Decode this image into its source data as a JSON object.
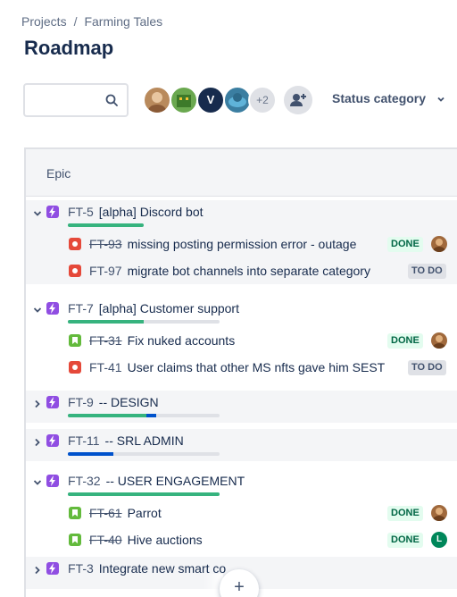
{
  "breadcrumb": {
    "root": "Projects",
    "separator": "/",
    "project": "Farming Tales"
  },
  "title": "Roadmap",
  "search": {
    "placeholder": "",
    "value": ""
  },
  "avatars": {
    "initial_v": "V",
    "more_count": "+2"
  },
  "filter": {
    "status_label": "Status category"
  },
  "table": {
    "header": "Epic"
  },
  "rows": [
    {
      "kind": "epic",
      "key": "FT-5",
      "summary": "[alpha] Discord bot",
      "expanded": true,
      "progress_done": 1.0,
      "progress_inprogress": 0
    },
    {
      "kind": "child",
      "type": "bug",
      "key": "FT-93",
      "summary": "missing posting permission error - outage",
      "status": "DONE",
      "resolved": true,
      "assignee": "photo"
    },
    {
      "kind": "child",
      "type": "bug",
      "key": "FT-97",
      "summary": "migrate bot channels into separate category",
      "status": "TO DO",
      "resolved": false
    },
    {
      "kind": "epic",
      "key": "FT-7",
      "summary": "[alpha] Customer support",
      "expanded": true,
      "progress_done": 0.5,
      "progress_inprogress": 0
    },
    {
      "kind": "child",
      "type": "story",
      "key": "FT-31",
      "summary": "Fix nuked accounts",
      "status": "DONE",
      "resolved": true,
      "assignee": "photo"
    },
    {
      "kind": "child",
      "type": "bug",
      "key": "FT-41",
      "summary": "User claims that other MS nfts gave him SEST",
      "status": "TO DO",
      "resolved": false
    },
    {
      "kind": "epic",
      "key": "FT-9",
      "summary": "-- DESIGN",
      "expanded": false,
      "progress_done": 0.52,
      "progress_inprogress": 0.06
    },
    {
      "kind": "epic",
      "key": "FT-11",
      "summary": "-- SRL ADMIN",
      "expanded": false,
      "progress_done": 0,
      "progress_inprogress": 0.3
    },
    {
      "kind": "epic",
      "key": "FT-32",
      "summary": "-- USER ENGAGEMENT",
      "expanded": true,
      "progress_done": 1.0,
      "progress_inprogress": 0
    },
    {
      "kind": "child",
      "type": "story",
      "key": "FT-61",
      "summary": "Parrot",
      "status": "DONE",
      "resolved": true,
      "assignee": "photo"
    },
    {
      "kind": "child",
      "type": "story",
      "key": "FT-40",
      "summary": "Hive auctions",
      "status": "DONE",
      "resolved": true,
      "assignee": "initial",
      "assignee_initial": "L"
    },
    {
      "kind": "epic",
      "key": "FT-3",
      "summary": "Integrate new smart co",
      "expanded": false,
      "progress_done": 0,
      "progress_inprogress": 0
    }
  ],
  "fab_label": "+",
  "colors": {
    "epic": "#904ee2",
    "bug": "#e5493a",
    "story": "#63ba3c",
    "done_bar": "#36b37e",
    "inprogress_bar": "#0052cc"
  }
}
